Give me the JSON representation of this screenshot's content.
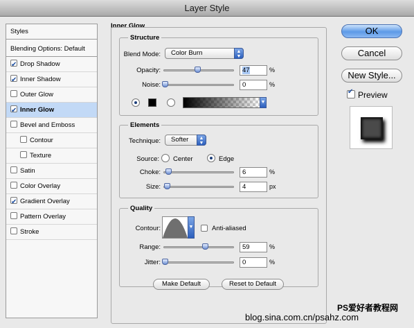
{
  "window": {
    "title": "Layer Style"
  },
  "sidebar": {
    "header": "Styles",
    "blending": "Blending Options: Default",
    "items": [
      {
        "label": "Drop Shadow",
        "checked": true,
        "selected": false,
        "indent": false
      },
      {
        "label": "Inner Shadow",
        "checked": true,
        "selected": false,
        "indent": false
      },
      {
        "label": "Outer Glow",
        "checked": false,
        "selected": false,
        "indent": false
      },
      {
        "label": "Inner Glow",
        "checked": true,
        "selected": true,
        "indent": false
      },
      {
        "label": "Bevel and Emboss",
        "checked": false,
        "selected": false,
        "indent": false
      },
      {
        "label": "Contour",
        "checked": false,
        "selected": false,
        "indent": true
      },
      {
        "label": "Texture",
        "checked": false,
        "selected": false,
        "indent": true
      },
      {
        "label": "Satin",
        "checked": false,
        "selected": false,
        "indent": false
      },
      {
        "label": "Color Overlay",
        "checked": false,
        "selected": false,
        "indent": false
      },
      {
        "label": "Gradient Overlay",
        "checked": true,
        "selected": false,
        "indent": false
      },
      {
        "label": "Pattern Overlay",
        "checked": false,
        "selected": false,
        "indent": false
      },
      {
        "label": "Stroke",
        "checked": false,
        "selected": false,
        "indent": false
      }
    ]
  },
  "panel": {
    "title": "Inner Glow",
    "structure": {
      "title": "Structure",
      "blend_label": "Blend Mode:",
      "blend_value": "Color Burn",
      "opacity_label": "Opacity:",
      "opacity_value": "47",
      "opacity_unit": "%",
      "noise_label": "Noise:",
      "noise_value": "0",
      "noise_unit": "%"
    },
    "elements": {
      "title": "Elements",
      "technique_label": "Technique:",
      "technique_value": "Softer",
      "source_label": "Source:",
      "center_label": "Center",
      "edge_label": "Edge",
      "choke_label": "Choke:",
      "choke_value": "6",
      "choke_unit": "%",
      "size_label": "Size:",
      "size_value": "4",
      "size_unit": "px"
    },
    "quality": {
      "title": "Quality",
      "contour_label": "Contour:",
      "antialiased_label": "Anti-aliased",
      "range_label": "Range:",
      "range_value": "59",
      "range_unit": "%",
      "jitter_label": "Jitter:",
      "jitter_value": "0",
      "jitter_unit": "%"
    },
    "make_default": "Make Default",
    "reset_default": "Reset to Default"
  },
  "buttons": {
    "ok": "OK",
    "cancel": "Cancel",
    "new_style": "New Style...",
    "preview": "Preview"
  },
  "watermark": {
    "line1": "PS爱好者教程网",
    "line2": "blog.sina.com.cn/psahz.com"
  },
  "colors": {
    "accent": "#5d9ae7",
    "selection": "#c2d9f6",
    "glow_color": "#000000"
  }
}
